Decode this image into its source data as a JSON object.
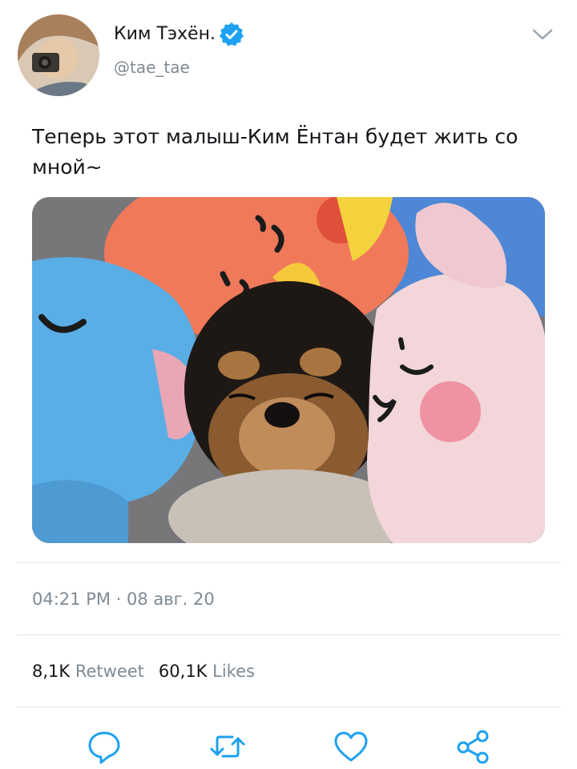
{
  "user": {
    "display_name": "Ким Тэхён.",
    "handle": "@tae_tae",
    "verified": true,
    "avatar_icon": "avatar-photo"
  },
  "tweet": {
    "text": "Теперь этот малыш-Ким Ёнтан будет жить со мной~",
    "media_description_icon": "photo-puppy-plush"
  },
  "meta": {
    "timestamp": "04:21 PM · 08 авг. 20"
  },
  "stats": {
    "retweets_count": "8,1K",
    "retweets_label": "Retweet",
    "likes_count": "60,1K",
    "likes_label": "Likes"
  },
  "actions": {
    "reply_icon": "reply-icon",
    "retweet_icon": "retweet-icon",
    "like_icon": "heart-icon",
    "share_icon": "share-icon"
  },
  "colors": {
    "verified": "#1da1f2",
    "secondary_text": "#7f8a93",
    "divider": "#e3e6e9",
    "icon": "#1da1f2"
  }
}
